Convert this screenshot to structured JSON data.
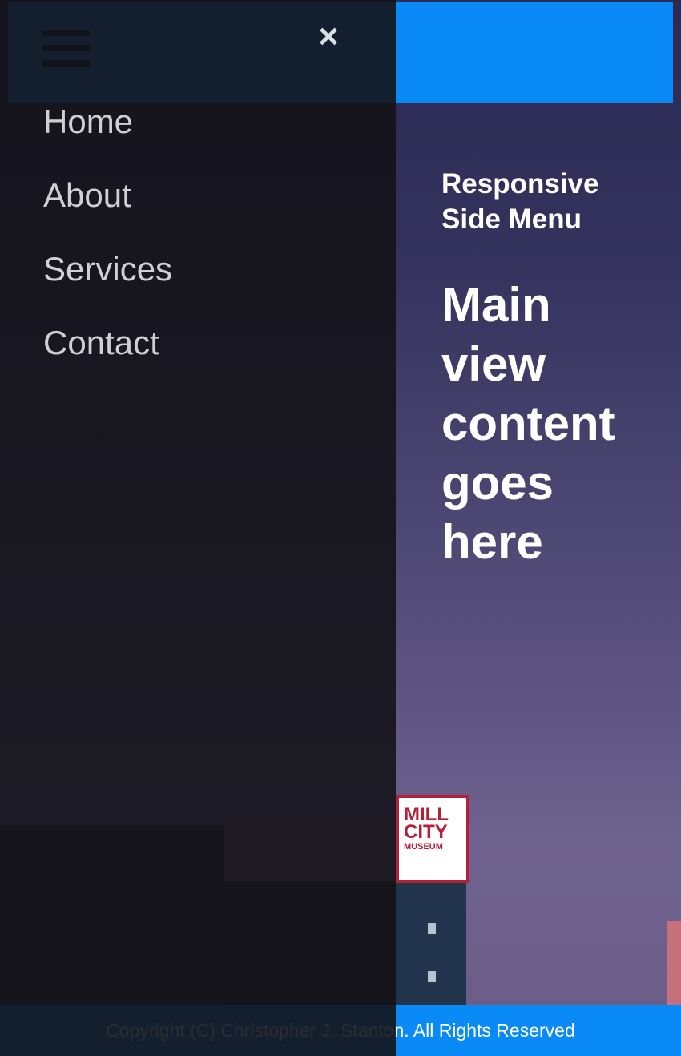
{
  "topbar": {
    "menu_icon": "hamburger-icon",
    "accent_color": "#0a8af7"
  },
  "sidemenu": {
    "close_label": "×",
    "items": [
      {
        "label": "Home"
      },
      {
        "label": "About"
      },
      {
        "label": "Services"
      },
      {
        "label": "Contact"
      }
    ]
  },
  "main": {
    "subtitle": "Responsive Side Menu",
    "headline": "Main view content goes here"
  },
  "background": {
    "sign_line1": "MILL",
    "sign_line2": "CITY",
    "sign_line3": "MUSEUM"
  },
  "footer": {
    "copyright": "Copyright (C) Christopher J. Stanton. All Rights Reserved"
  }
}
